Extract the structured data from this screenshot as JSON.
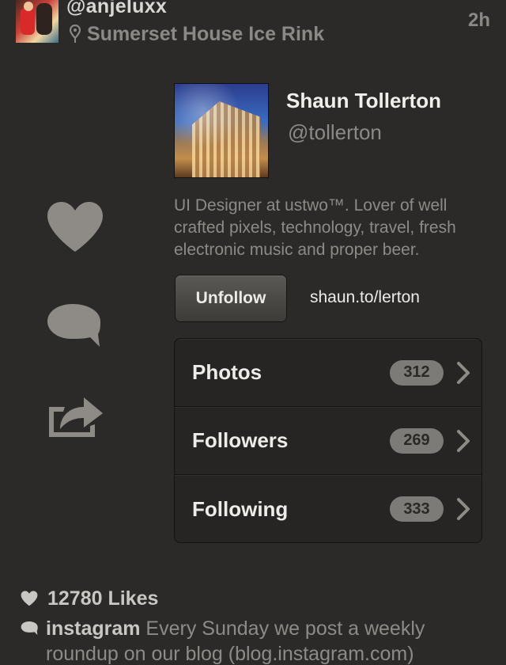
{
  "header": {
    "username": "@anjeluxx",
    "location": "Sumerset House Ice Rink",
    "time": "2h"
  },
  "icons": {
    "location": "map-pin-icon",
    "like": "heart-icon",
    "comment": "speech-bubble-icon",
    "share": "share-icon",
    "chevron": "chevron-right-icon"
  },
  "profile": {
    "name": "Shaun Tollerton",
    "handle": "@tollerton",
    "bio": "UI Designer at ustwo™. Lover of well crafted pixels, technology, travel, fresh electronic music and proper beer.",
    "unfollow_label": "Unfollow",
    "website": "shaun.to/lerton",
    "stats": [
      {
        "label": "Photos",
        "count": "312"
      },
      {
        "label": "Followers",
        "count": "269"
      },
      {
        "label": "Following",
        "count": "333"
      }
    ]
  },
  "footer": {
    "likes": "12780 Likes",
    "caption_user": "instagram",
    "caption_text": " Every Sunday we post a weekly roundup on our blog (blog.instagram.com)"
  },
  "colors": {
    "background": "#2b2a28",
    "icon_gray": "#8e8b86",
    "badge": "#7d7b77"
  }
}
